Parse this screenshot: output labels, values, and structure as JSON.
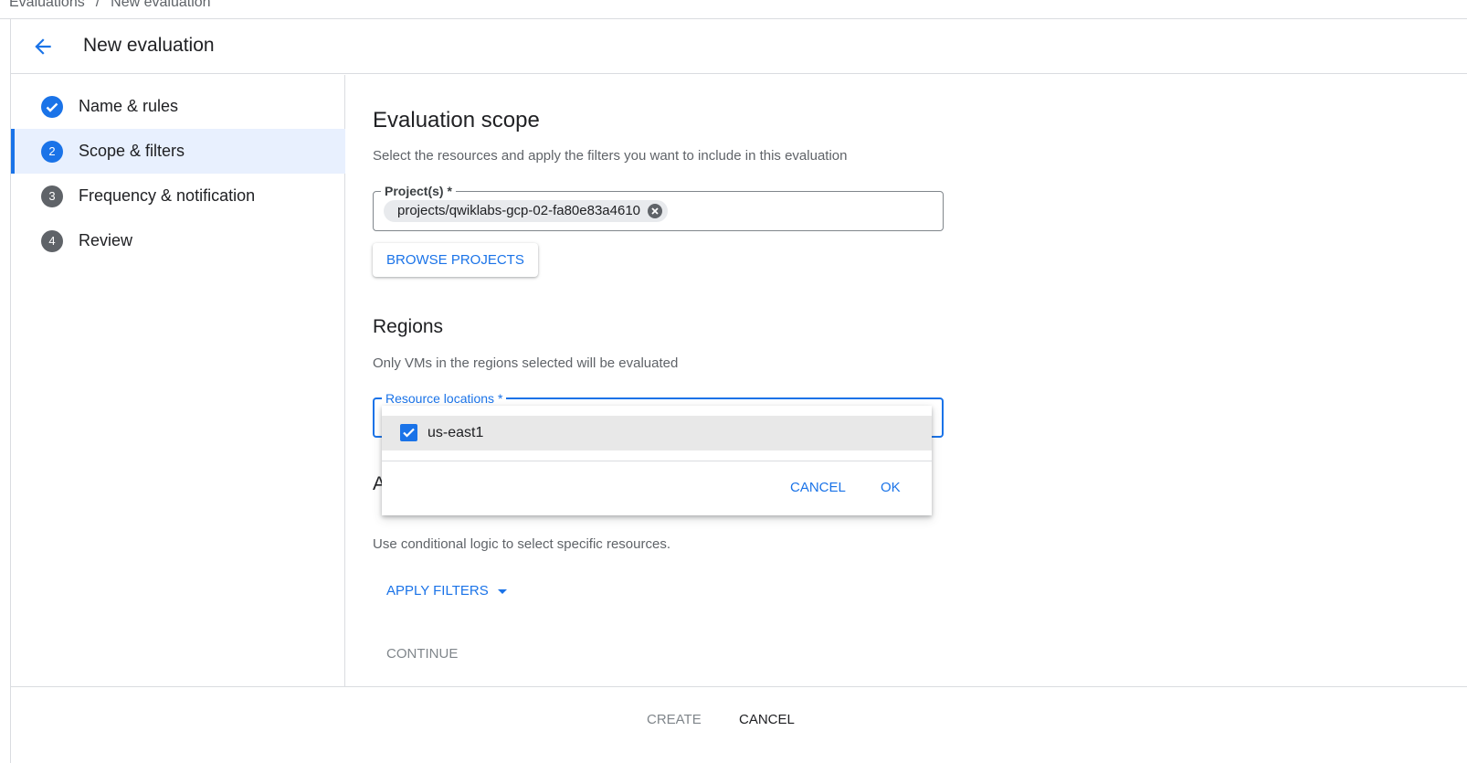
{
  "breadcrumb": {
    "parent": "Evaluations",
    "separator": "/",
    "current": "New evaluation"
  },
  "header": {
    "title": "New evaluation",
    "back_icon": "arrow-back-icon"
  },
  "steps": [
    {
      "number": "",
      "label": "Name & rules",
      "state": "completed"
    },
    {
      "number": "2",
      "label": "Scope & filters",
      "state": "active"
    },
    {
      "number": "3",
      "label": "Frequency & notification",
      "state": "pending"
    },
    {
      "number": "4",
      "label": "Review",
      "state": "pending"
    }
  ],
  "scope": {
    "title": "Evaluation scope",
    "description": "Select the resources and apply the filters you want to include in this evaluation",
    "projects_label": "Project(s) *",
    "project_chip": "projects/qwiklabs-gcp-02-fa80e83a4610",
    "browse_button": "BROWSE PROJECTS"
  },
  "regions": {
    "title": "Regions",
    "description": "Only VMs in the regions selected will be evaluated",
    "field_label": "Resource locations *"
  },
  "filters": {
    "title_partial": "A",
    "description": "Use conditional logic to select specific resources.",
    "apply_button": "APPLY FILTERS"
  },
  "continue_button": "CONTINUE",
  "dropdown": {
    "options": [
      {
        "label": "us-east1",
        "checked": true
      }
    ],
    "cancel": "CANCEL",
    "ok": "OK"
  },
  "footer": {
    "create": "CREATE",
    "cancel": "CANCEL"
  },
  "colors": {
    "accent": "#1a73e8",
    "text": "#202124",
    "muted": "#5f6368",
    "disabled": "#80868b",
    "step_pending": "#5f6368"
  }
}
